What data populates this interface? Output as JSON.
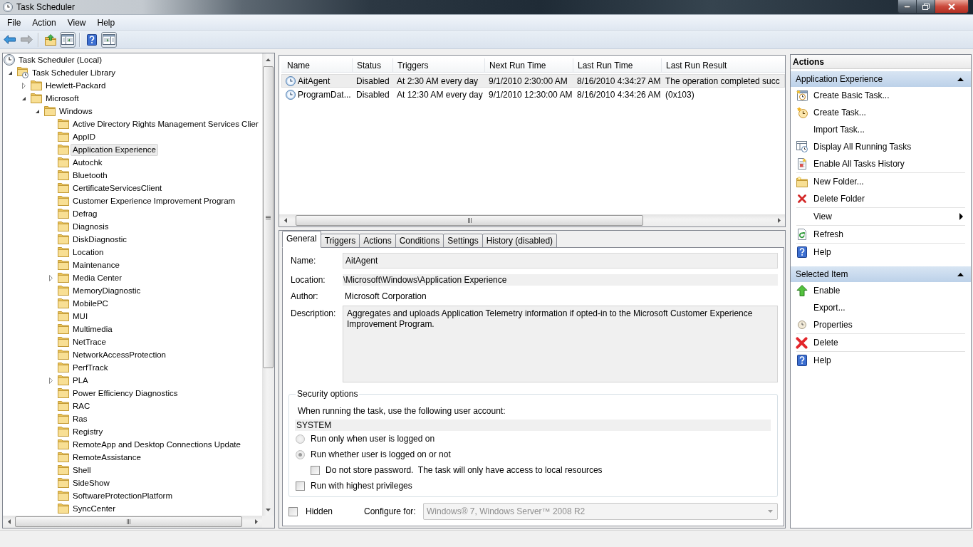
{
  "window": {
    "title": "Task Scheduler"
  },
  "menu": [
    "File",
    "Action",
    "View",
    "Help"
  ],
  "toolbar": [
    {
      "kind": "back",
      "disabled": false,
      "on": false
    },
    {
      "kind": "forward",
      "disabled": true,
      "on": false
    },
    {
      "kind": "separator"
    },
    {
      "kind": "up",
      "disabled": false,
      "on": false
    },
    {
      "kind": "tree",
      "disabled": false,
      "on": true
    },
    {
      "kind": "separator"
    },
    {
      "kind": "help",
      "disabled": false,
      "on": false
    },
    {
      "kind": "pane",
      "disabled": false,
      "on": true
    }
  ],
  "tree": [
    {
      "label": "Task Scheduler (Local)",
      "kind": "root",
      "selected": false,
      "children": [
        {
          "label": "Task Scheduler Library",
          "kind": "library",
          "expanded": true,
          "selected": false,
          "children": [
            {
              "label": "Hewlett-Packard",
              "kind": "folder",
              "expanded": false,
              "selected": false
            },
            {
              "label": "Microsoft",
              "kind": "folder",
              "expanded": true,
              "selected": false,
              "children": [
                {
                  "label": "Windows",
                  "kind": "folder",
                  "expanded": true,
                  "selected": false,
                  "children": [
                    {
                      "label": "Active Directory Rights Management Services Clier",
                      "kind": "folder",
                      "selected": false
                    },
                    {
                      "label": "AppID",
                      "kind": "folder",
                      "selected": false
                    },
                    {
                      "label": "Application Experience",
                      "kind": "folder",
                      "selected": true
                    },
                    {
                      "label": "Autochk",
                      "kind": "folder",
                      "selected": false
                    },
                    {
                      "label": "Bluetooth",
                      "kind": "folder",
                      "selected": false
                    },
                    {
                      "label": "CertificateServicesClient",
                      "kind": "folder",
                      "selected": false
                    },
                    {
                      "label": "Customer Experience Improvement Program",
                      "kind": "folder",
                      "selected": false
                    },
                    {
                      "label": "Defrag",
                      "kind": "folder",
                      "selected": false
                    },
                    {
                      "label": "Diagnosis",
                      "kind": "folder",
                      "selected": false
                    },
                    {
                      "label": "DiskDiagnostic",
                      "kind": "folder",
                      "selected": false
                    },
                    {
                      "label": "Location",
                      "kind": "folder",
                      "selected": false
                    },
                    {
                      "label": "Maintenance",
                      "kind": "folder",
                      "selected": false
                    },
                    {
                      "label": "Media Center",
                      "kind": "folder",
                      "expanded": false,
                      "selected": false
                    },
                    {
                      "label": "MemoryDiagnostic",
                      "kind": "folder",
                      "selected": false
                    },
                    {
                      "label": "MobilePC",
                      "kind": "folder",
                      "selected": false
                    },
                    {
                      "label": "MUI",
                      "kind": "folder",
                      "selected": false
                    },
                    {
                      "label": "Multimedia",
                      "kind": "folder",
                      "selected": false
                    },
                    {
                      "label": "NetTrace",
                      "kind": "folder",
                      "selected": false
                    },
                    {
                      "label": "NetworkAccessProtection",
                      "kind": "folder",
                      "selected": false
                    },
                    {
                      "label": "PerfTrack",
                      "kind": "folder",
                      "selected": false
                    },
                    {
                      "label": "PLA",
                      "kind": "folder",
                      "expanded": false,
                      "selected": false
                    },
                    {
                      "label": "Power Efficiency Diagnostics",
                      "kind": "folder",
                      "selected": false
                    },
                    {
                      "label": "RAC",
                      "kind": "folder",
                      "selected": false
                    },
                    {
                      "label": "Ras",
                      "kind": "folder",
                      "selected": false
                    },
                    {
                      "label": "Registry",
                      "kind": "folder",
                      "selected": false
                    },
                    {
                      "label": "RemoteApp and Desktop Connections Update",
                      "kind": "folder",
                      "selected": false
                    },
                    {
                      "label": "RemoteAssistance",
                      "kind": "folder",
                      "selected": false
                    },
                    {
                      "label": "Shell",
                      "kind": "folder",
                      "selected": false
                    },
                    {
                      "label": "SideShow",
                      "kind": "folder",
                      "selected": false
                    },
                    {
                      "label": "SoftwareProtectionPlatform",
                      "kind": "folder",
                      "selected": false
                    },
                    {
                      "label": "SyncCenter",
                      "kind": "folder",
                      "selected": false
                    }
                  ]
                }
              ]
            }
          ]
        }
      ]
    }
  ],
  "task_list": {
    "columns": [
      "Name",
      "Status",
      "Triggers",
      "Next Run Time",
      "Last Run Time",
      "Last Run Result"
    ],
    "rows": [
      {
        "selected": true,
        "cells": [
          "AitAgent",
          "Disabled",
          "At 2:30 AM every day",
          "9/1/2010 2:30:00 AM",
          "8/16/2010 4:34:27 AM",
          "The operation completed succ"
        ]
      },
      {
        "selected": false,
        "cells": [
          "ProgramDat...",
          "Disabled",
          "At 12:30 AM every day",
          "9/1/2010 12:30:00 AM",
          "8/16/2010 4:34:26 AM",
          "(0x103)"
        ]
      }
    ]
  },
  "details": {
    "tabs": [
      {
        "label": "General",
        "selected": true
      },
      {
        "label": "Triggers",
        "selected": false
      },
      {
        "label": "Actions",
        "selected": false
      },
      {
        "label": "Conditions",
        "selected": false
      },
      {
        "label": "Settings",
        "selected": false
      },
      {
        "label": "History (disabled)",
        "selected": false
      }
    ],
    "name": {
      "label": "Name:",
      "value": "AitAgent"
    },
    "location": {
      "label": "Location:",
      "value": "\\Microsoft\\Windows\\Application Experience"
    },
    "author": {
      "label": "Author:",
      "value": "Microsoft Corporation"
    },
    "description": {
      "label": "Description:",
      "value": "Aggregates and uploads Application Telemetry information if opted-in to the Microsoft Customer Experience Improvement Program."
    },
    "security_options": {
      "title": "Security options",
      "account_prompt": "When running the task, use the following user account:",
      "account": "SYSTEM",
      "logon_modes": [
        {
          "label": "Run only when user is logged on",
          "selected": false
        },
        {
          "label": "Run whether user is logged on or not",
          "selected": true
        }
      ],
      "do_not_store_password": {
        "label": "Do not store password.  The task will only have access to local resources",
        "checked": false
      },
      "highest_privileges": {
        "label": "Run with highest privileges",
        "checked": false
      }
    },
    "hidden": {
      "label": "Hidden",
      "checked": false
    },
    "configure_for": {
      "label": "Configure for:",
      "value": "Windows® 7, Windows Server™ 2008 R2",
      "disabled": true
    }
  },
  "actions": {
    "title": "Actions",
    "sections": [
      {
        "title": "Application Experience",
        "expanded": true,
        "groups": [
          [
            {
              "label": "Create Basic Task...",
              "kind": "basictask"
            },
            {
              "label": "Create Task...",
              "kind": "task"
            },
            {
              "label": "Import Task...",
              "kind": "plain"
            },
            {
              "label": "Display All Running Tasks",
              "kind": "running"
            },
            {
              "label": "Enable All Tasks History",
              "kind": "history"
            }
          ],
          [
            {
              "label": "New Folder...",
              "kind": "newfolder"
            },
            {
              "label": "Delete Folder",
              "kind": "deletefolder"
            }
          ],
          [
            {
              "label": "View",
              "kind": "submenu"
            }
          ],
          [
            {
              "label": "Refresh",
              "kind": "refresh"
            }
          ],
          [
            {
              "label": "Help",
              "kind": "help"
            }
          ]
        ]
      },
      {
        "title": "Selected Item",
        "expanded": true,
        "groups": [
          [
            {
              "label": "Enable",
              "kind": "enable"
            },
            {
              "label": "Export...",
              "kind": "plain"
            },
            {
              "label": "Properties",
              "kind": "properties"
            }
          ],
          [
            {
              "label": "Delete",
              "kind": "delete"
            }
          ],
          [
            {
              "label": "Help",
              "kind": "help"
            }
          ]
        ]
      }
    ]
  }
}
